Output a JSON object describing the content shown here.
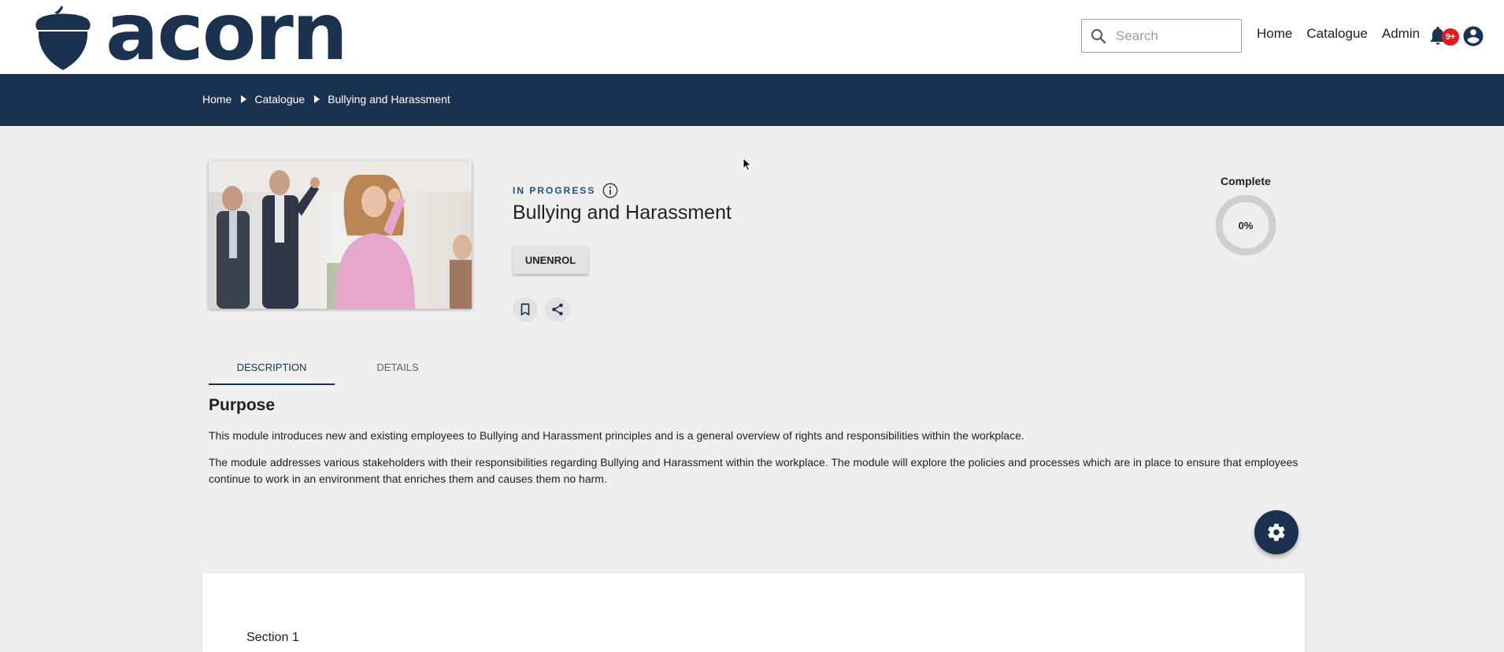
{
  "brand": {
    "logo_text": "acorn",
    "color": "#1b3150"
  },
  "header": {
    "search_placeholder": "Search",
    "nav": [
      "Home",
      "Catalogue",
      "Admin"
    ],
    "notification_badge": "9+",
    "icons": {
      "search": "search-icon",
      "notifications": "bell-icon",
      "account": "account-circle-icon"
    }
  },
  "breadcrumb": [
    "Home",
    "Catalogue",
    "Bullying and Harassment"
  ],
  "course": {
    "status": "IN PROGRESS",
    "title": "Bullying and Harassment",
    "unenrol_label": "UNENROL",
    "progress_label": "Complete",
    "progress_value": "0%",
    "progress_fraction": 0,
    "status_color": "#1e4f87"
  },
  "tabs": [
    "DESCRIPTION",
    "DETAILS"
  ],
  "description": {
    "heading": "Purpose",
    "paragraphs": [
      "This module introduces new and existing employees to Bullying and Harassment principles and is a general overview of rights and responsibilities within the workplace.",
      "The module addresses various stakeholders with their responsibilities regarding Bullying and Harassment within the workplace. The module will explore the policies and processes which are in place to ensure that employees continue to work in an environment that enriches them and causes them no harm."
    ]
  },
  "sections": [
    {
      "title": "Section 1"
    }
  ]
}
